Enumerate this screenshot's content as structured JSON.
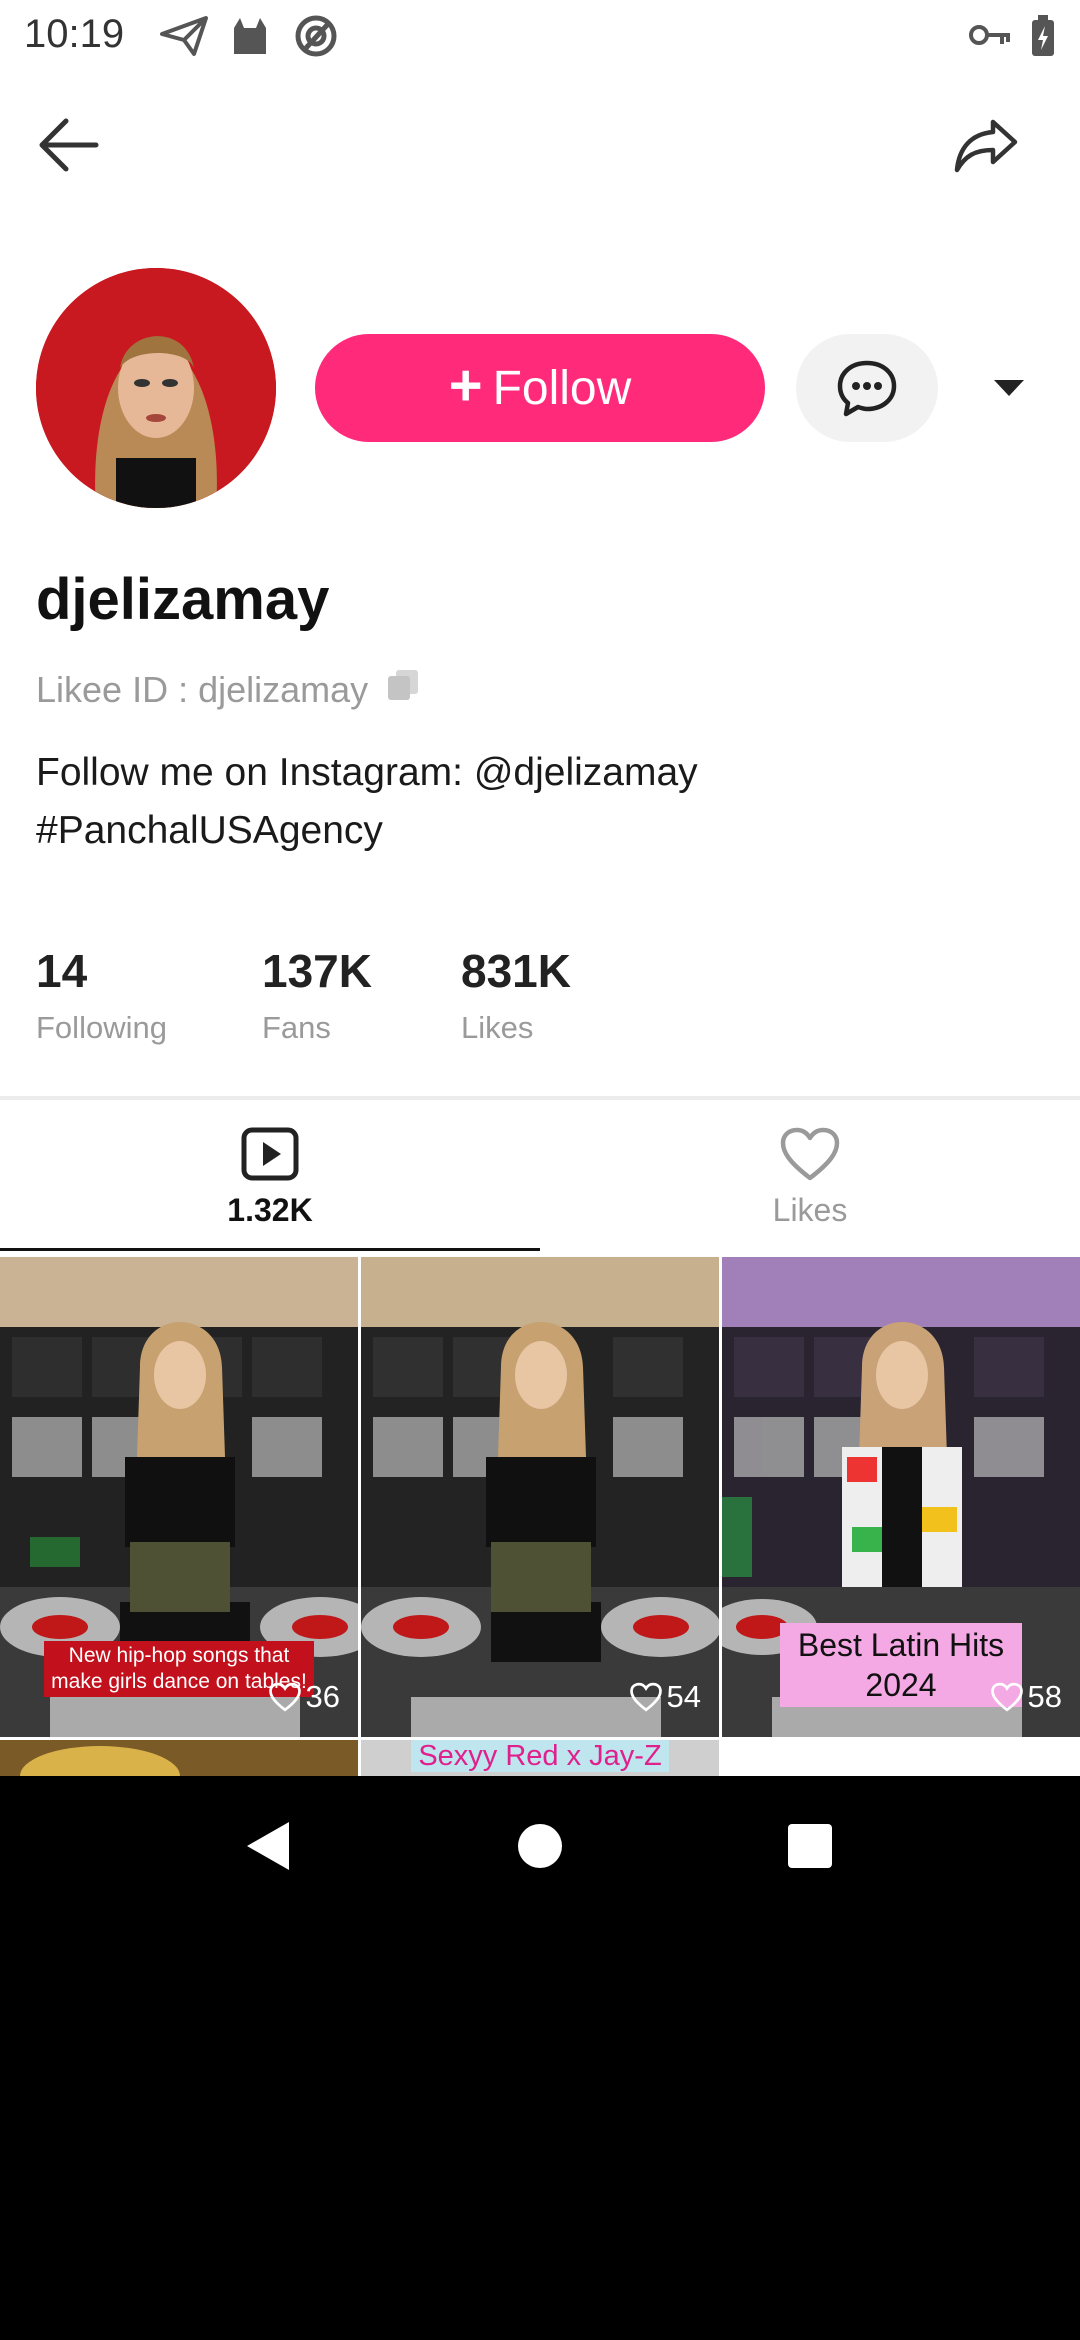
{
  "status_bar": {
    "time": "10:19"
  },
  "profile": {
    "username": "djelizamay",
    "likee_id": "Likee ID : djelizamay",
    "bio_line1": "Follow me on Instagram: @djelizamay",
    "bio_line2": "#PanchalUSAgency",
    "follow_label": "Follow"
  },
  "stats": [
    {
      "value": "14",
      "label": "Following"
    },
    {
      "value": "137K",
      "label": "Fans"
    },
    {
      "value": "831K",
      "label": "Likes"
    }
  ],
  "tabs": [
    {
      "label": "1.32K",
      "icon": "video-icon",
      "selected": true
    },
    {
      "label": "Likes",
      "icon": "heart-icon",
      "selected": false
    }
  ],
  "videos": [
    {
      "caption": "New hip-hop songs that make girls dance on tables!",
      "likes": "36"
    },
    {
      "caption": "",
      "likes": "54"
    },
    {
      "caption": "Best Latin Hits 2024",
      "likes": "58"
    },
    {
      "caption": "",
      "likes": ""
    },
    {
      "caption": "Sexyy Red x Jay-Z",
      "likes": ""
    }
  ],
  "colors": {
    "accent": "#ff2a7a",
    "muted": "#9a9a9a"
  }
}
